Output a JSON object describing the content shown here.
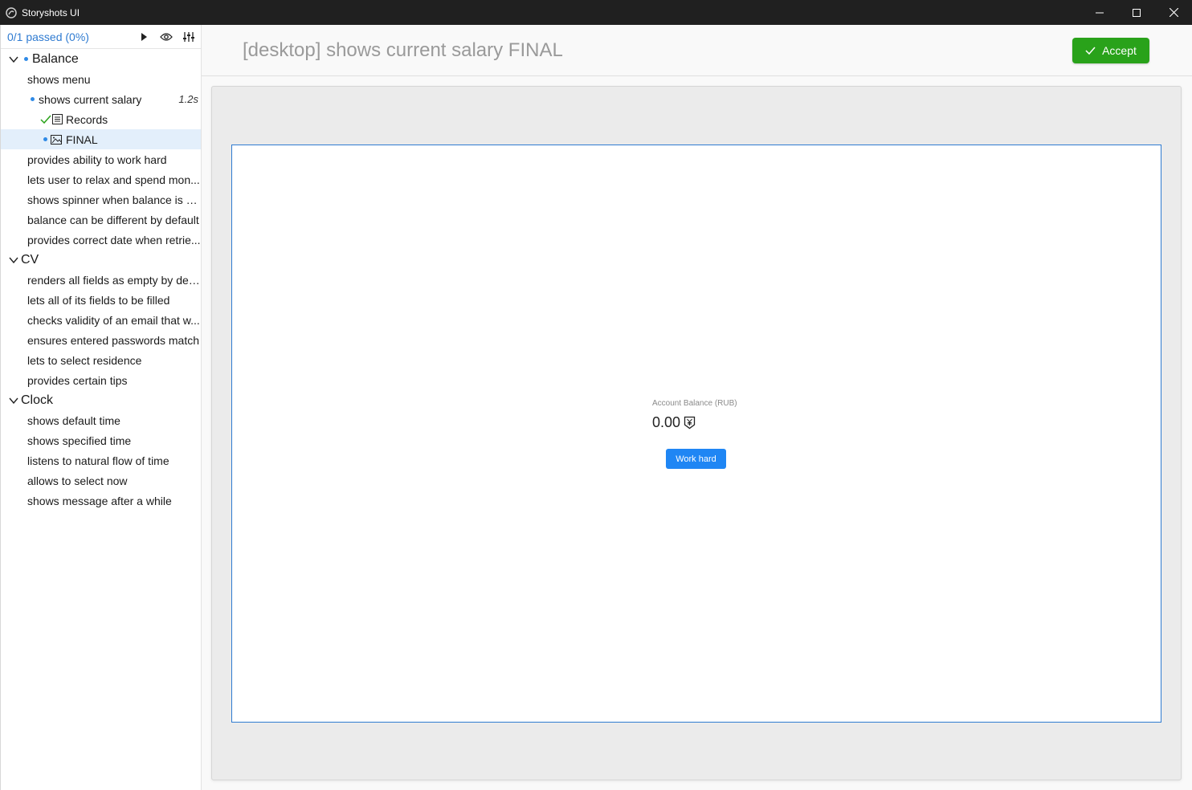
{
  "window": {
    "title": "Storyshots UI",
    "controls": [
      "minimize-icon",
      "maximize-icon",
      "close-icon"
    ]
  },
  "sidebar": {
    "status": "0/1 passed (0%)",
    "toolbar_icons": [
      "play-icon",
      "eye-icon",
      "equalizer-icon"
    ],
    "groups": [
      {
        "label": "Balance",
        "items": [
          "shows menu",
          "shows current salary",
          "Records",
          "FINAL",
          "provides ability to work hard",
          "lets user to relax and spend mon...",
          "shows spinner when balance is n...",
          "balance can be different by default",
          "provides correct date when retrie..."
        ],
        "duration": "1.2s"
      },
      {
        "label": "CV",
        "items": [
          "renders all fields as empty by def...",
          "lets all of its fields to be filled",
          "checks validity of an email that w...",
          "ensures entered passwords match",
          "lets to select residence",
          "provides certain tips"
        ]
      },
      {
        "label": "Clock",
        "items": [
          "shows default time",
          "shows specified time",
          "listens to natural flow of time",
          "allows to select now",
          "shows message after a while"
        ]
      }
    ]
  },
  "main": {
    "title": "[desktop] shows current salary FINAL",
    "accept_label": "Accept",
    "preview": {
      "balance_label": "Account Balance (RUB)",
      "balance_value": "0.00",
      "work_button": "Work hard"
    }
  },
  "colors": {
    "accent": "#2f7bd1",
    "accept": "#29a21a",
    "work_button": "#1f86f4",
    "selected_row": "#e3effb",
    "titlebar": "#202020"
  }
}
